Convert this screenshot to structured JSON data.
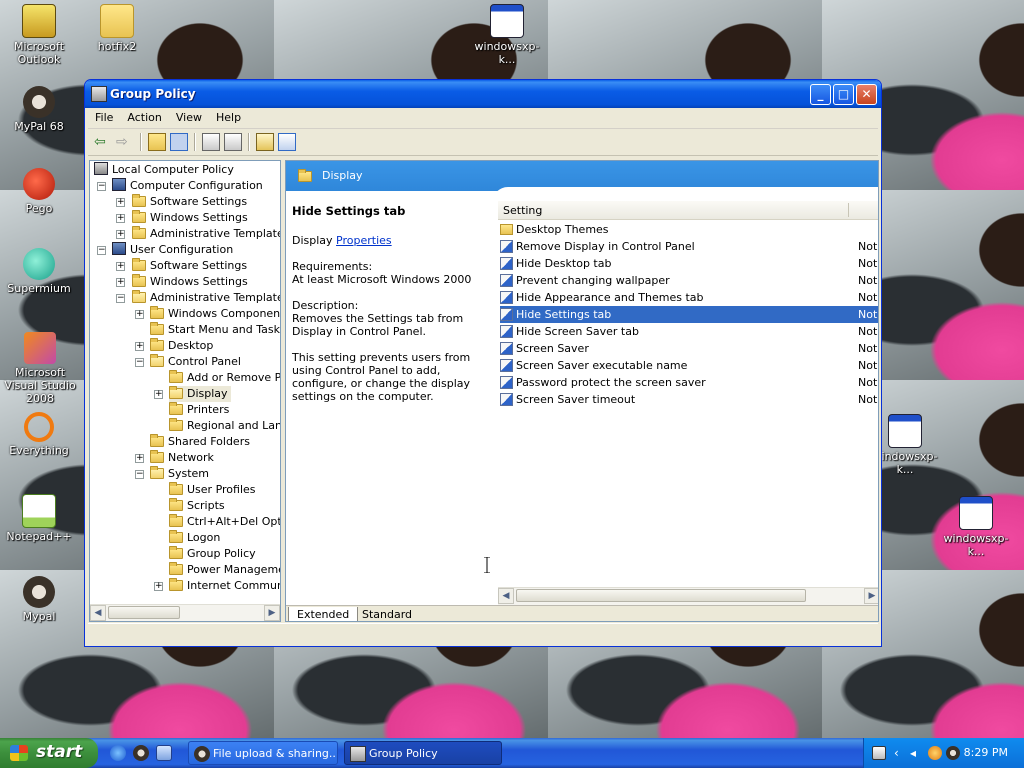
{
  "desktop": {
    "icons": [
      {
        "label": "Microsoft Outlook"
      },
      {
        "label": "hotfix2"
      },
      {
        "label": "windowsxp-k..."
      },
      {
        "label": "MyPal 68"
      },
      {
        "label": "Pego"
      },
      {
        "label": "Supermium"
      },
      {
        "label": "Microsoft Visual Studio 2008"
      },
      {
        "label": "Everything"
      },
      {
        "label": "Notepad++"
      },
      {
        "label": "Mypal"
      },
      {
        "label": "windowsxp-k..."
      },
      {
        "label": "windowsxp-k..."
      }
    ]
  },
  "window": {
    "title": "Group Policy",
    "menu": [
      "File",
      "Action",
      "View",
      "Help"
    ]
  },
  "tree": {
    "root": "Local Computer Policy",
    "nodes": [
      "Computer Configuration",
      "Software Settings",
      "Windows Settings",
      "Administrative Templates",
      "User Configuration",
      "Software Settings",
      "Windows Settings",
      "Administrative Templates",
      "Windows Components",
      "Start Menu and Taskba",
      "Desktop",
      "Control Panel",
      "Add or Remove Pro",
      "Display",
      "Printers",
      "Regional and Langu",
      "Shared Folders",
      "Network",
      "System",
      "User Profiles",
      "Scripts",
      "Ctrl+Alt+Del Optio",
      "Logon",
      "Group Policy",
      "Power Managemen",
      "Internet Communic"
    ]
  },
  "details": {
    "header": "Display",
    "title": "Hide Settings tab",
    "display_label": "Display",
    "properties_link": "Properties",
    "requirements_label": "Requirements:",
    "requirements": "At least Microsoft Windows 2000",
    "description_label": "Description:",
    "description": "Removes the Settings tab from Display in Control Panel.",
    "description2": "This setting prevents users from using Control Panel to add, configure, or change the display settings on the computer."
  },
  "list": {
    "column_setting": "Setting",
    "rows": [
      {
        "name": "Desktop Themes",
        "state": ""
      },
      {
        "name": "Remove Display in Control Panel",
        "state": "Not"
      },
      {
        "name": "Hide Desktop tab",
        "state": "Not"
      },
      {
        "name": "Prevent changing wallpaper",
        "state": "Not"
      },
      {
        "name": "Hide Appearance and Themes tab",
        "state": "Not"
      },
      {
        "name": "Hide Settings tab",
        "state": "Not"
      },
      {
        "name": "Hide Screen Saver tab",
        "state": "Not"
      },
      {
        "name": "Screen Saver",
        "state": "Not"
      },
      {
        "name": "Screen Saver executable name",
        "state": "Not"
      },
      {
        "name": "Password protect the screen saver",
        "state": "Not"
      },
      {
        "name": "Screen Saver timeout",
        "state": "Not"
      }
    ]
  },
  "tabs": {
    "extended": "Extended",
    "standard": "Standard"
  },
  "taskbar": {
    "start": "start",
    "tasks": [
      {
        "label": "File upload & sharing...."
      },
      {
        "label": "Group Policy"
      }
    ],
    "clock": "8:29 PM"
  }
}
